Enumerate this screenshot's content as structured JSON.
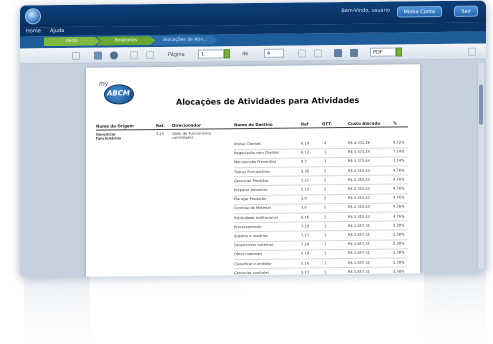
{
  "titlebar": {
    "welcome": "Bem-Vindo, usuario",
    "primary_button": "Minha Conta",
    "exit_button": "Sair"
  },
  "menu": {
    "items": [
      "Home",
      "Ajuda"
    ]
  },
  "breadcrumbs": [
    "Inicio",
    "Relatorios",
    "Alocações de Ativ..."
  ],
  "toolbar": {
    "page_label": "Página",
    "page_value": "1",
    "of_label": "de",
    "total_pages": "4",
    "zoom_value": "PDF"
  },
  "report": {
    "logo_small": "my",
    "logo_text": "ABCM",
    "title": "Alocações de Atividades para Atividades",
    "headers": [
      "Nome da Origem",
      "Ref.",
      "Direcionador",
      "Nome do Destino",
      "Ref",
      "QTT.",
      "Custo Alocado",
      "%"
    ],
    "origin_name": "Gerenciar funcionários",
    "origin_ref": "3.25",
    "driver": "Qtde. de Funcionários contratados",
    "rows": [
      {
        "dest": "Visitar Clientes",
        "ref": "6.10",
        "qtt": "4",
        "cost": "R$ 4.331,26",
        "pct": "9,52%"
      },
      {
        "dest": "Negociação com Clientes",
        "ref": "6.12",
        "qtt": "3",
        "cost": "R$ 3.373,44",
        "pct": "7,14%"
      },
      {
        "dest": "Manutenção Preventiva",
        "ref": "9.3",
        "qtt": "3",
        "cost": "R$ 3.373,44",
        "pct": "7,14%"
      },
      {
        "dest": "Treinar Funcionários",
        "ref": "3.30",
        "qtt": "2",
        "cost": "R$ 2.310,43",
        "pct": "4,76%"
      },
      {
        "dest": "Gerenciar Produtos",
        "ref": "5.21",
        "qtt": "2",
        "cost": "R$ 2.310,43",
        "pct": "4,76%"
      },
      {
        "dest": "Preparar Amostras",
        "ref": "5.12",
        "qtt": "2",
        "cost": "R$ 2.310,43",
        "pct": "4,76%"
      },
      {
        "dest": "Planejar Produção",
        "ref": "3.9",
        "qtt": "2",
        "cost": "R$ 2.310,43",
        "pct": "4,76%"
      },
      {
        "dest": "Controle de Material",
        "ref": "3.6",
        "qtt": "2",
        "cost": "R$ 2.310,43",
        "pct": "4,76%"
      },
      {
        "dest": "Publicidade Institucional",
        "ref": "6.16",
        "qtt": "2",
        "cost": "R$ 2.310,43",
        "pct": "4,76%"
      },
      {
        "dest": "Processamento",
        "ref": "7.10",
        "qtt": "1",
        "cost": "R$ 1.857,31",
        "pct": "2,38%"
      },
      {
        "dest": "Suporte a usuários",
        "ref": "7.17",
        "qtt": "1",
        "cost": "R$ 1.857,31",
        "pct": "2,38%"
      },
      {
        "dest": "Desenvolver sistemas",
        "ref": "7.20",
        "qtt": "1",
        "cost": "R$ 1.857,31",
        "pct": "2,38%"
      },
      {
        "dest": "Obter materiais",
        "ref": "5.19",
        "qtt": "1",
        "cost": "R$ 1.857,31",
        "pct": "2,38%"
      },
      {
        "dest": "Classificar e embalar",
        "ref": "5.16",
        "qtt": "1",
        "cost": "R$ 1.857,31",
        "pct": "2,38%"
      },
      {
        "dest": "Gerenciar controles",
        "ref": "3.23",
        "qtt": "1",
        "cost": "R$ 1.857,31",
        "pct": "2,38%"
      }
    ]
  },
  "colors": {
    "titlebar": "#0d3f7a",
    "breadcrumb_active": "#7fb93f",
    "logo_blue": "#13457e"
  }
}
